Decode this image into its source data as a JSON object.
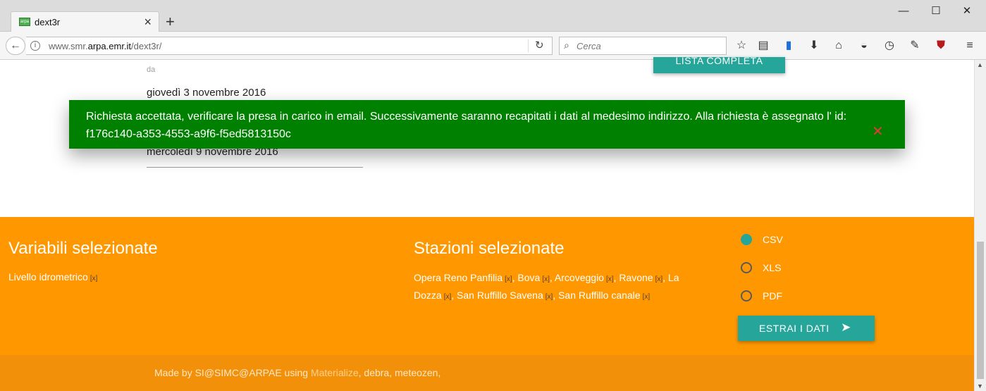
{
  "browser": {
    "tab_title": "dext3r",
    "favicon_text": "arpa",
    "url_host": "www.smr.",
    "url_domain": "arpa.emr.it",
    "url_path": "/dext3r/",
    "search_placeholder": "Cerca"
  },
  "form": {
    "label_from": "da",
    "date_from": "giovedì 3 novembre 2016",
    "date_to": "mercoledì 9 novembre 2016",
    "list_button": "LISTA COMPLETA"
  },
  "toast": {
    "message": "Richiesta accettata, verificare la presa in carico in email. Successivamente saranno recapitati i dati al medesimo indirizzo. Alla richiesta è assegnato l' id: f176c140-a353-4553-a9f6-f5ed5813150c",
    "close_glyph": "✕"
  },
  "selection": {
    "variables_title": "Variabili selezionate",
    "variables": [
      {
        "name": "Livello idrometrico",
        "remove": "[x]"
      }
    ],
    "stations_title": "Stazioni selezionate",
    "stations": [
      {
        "name": "Opera Reno Panfilia",
        "remove": "[x]"
      },
      {
        "name": "Bova",
        "remove": "[x]"
      },
      {
        "name": "Arcoveggio",
        "remove": "[x]"
      },
      {
        "name": "Ravone",
        "remove": "[x]"
      },
      {
        "name": "La Dozza",
        "remove": "[x]"
      },
      {
        "name": "San Ruffillo Savena",
        "remove": "[x]"
      },
      {
        "name": "San Ruffillo canale",
        "remove": "[x]"
      }
    ],
    "formats": [
      {
        "label": "CSV",
        "selected": true
      },
      {
        "label": "XLS",
        "selected": false
      },
      {
        "label": "PDF",
        "selected": false
      }
    ],
    "extract_button": "ESTRAI I DATI"
  },
  "footer": {
    "prefix": "Made by SI@SIMC@ARPAE using ",
    "link": "Materialize",
    "suffix": ", debra, meteozen,"
  },
  "colors": {
    "accent": "#26a69a",
    "orange": "#ff9800",
    "toast": "#008000",
    "close": "#e53935"
  }
}
